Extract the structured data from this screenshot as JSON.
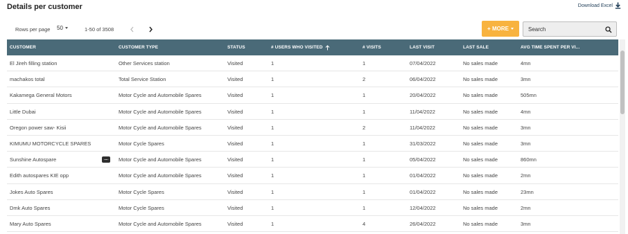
{
  "page": {
    "title": "Details per customer",
    "download_label": "Download Excel"
  },
  "toolbar": {
    "rows_per_page_label": "Rows per page",
    "rows_per_page_value": "50",
    "range_text": "1-50 of 3508",
    "more_label": "+ MORE",
    "search_placeholder": "Search"
  },
  "columns": [
    "CUSTOMER",
    "CUSTOMER TYPE",
    "STATUS",
    "# USERS WHO VISITED",
    "# VISITS",
    "LAST VISIT",
    "LAST SALE",
    "AVG TIME SPENT PER VI..."
  ],
  "sort": {
    "column": "# USERS WHO VISITED",
    "direction": "ascending"
  },
  "rows": [
    [
      "El Jireh filling station",
      "Other Services station",
      "Visited",
      "1",
      "1",
      "07/04/2022",
      "No sales made",
      "4mn"
    ],
    [
      "machakos total",
      "Total Service Station",
      "Visited",
      "1",
      "2",
      "06/04/2022",
      "No sales made",
      "3mn"
    ],
    [
      "Kakamega General Motors",
      "Motor Cycle and Automobile Spares",
      "Visited",
      "1",
      "1",
      "20/04/2022",
      "No sales made",
      "505mn"
    ],
    [
      "Little Dubai",
      "Motor Cycle and Automobile Spares",
      "Visited",
      "1",
      "1",
      "11/04/2022",
      "No sales made",
      "4mn"
    ],
    [
      "Oregon power saw- Kisii",
      "Motor Cycle and Automobile Spares",
      "Visited",
      "1",
      "2",
      "11/04/2022",
      "No sales made",
      "3mn"
    ],
    [
      "KIMUMU MOTORCYCLE SPARES",
      "Motor Cycle Spares",
      "Visited",
      "1",
      "1",
      "31/03/2022",
      "No sales made",
      "3mn"
    ],
    [
      "Sunshine Autospare",
      "Motor Cycle and Automobile Spares",
      "Visited",
      "1",
      "1",
      "05/04/2022",
      "No sales made",
      "860mn"
    ],
    [
      "Edith autospares KIE opp",
      "Motor Cycle and Automobile Spares",
      "Visited",
      "1",
      "1",
      "01/04/2022",
      "No sales made",
      "2mn"
    ],
    [
      "Jokes Auto Spares",
      "Motor Cycle Spares",
      "Visited",
      "1",
      "1",
      "01/04/2022",
      "No sales made",
      "23mn"
    ],
    [
      "Dmk Auto Spares",
      "Motor Cycle Spares",
      "Visited",
      "1",
      "1",
      "12/04/2022",
      "No sales made",
      "2mn"
    ],
    [
      "Mary Auto Spares",
      "Motor Cycle and Automobile Spares",
      "Visited",
      "1",
      "4",
      "26/04/2022",
      "No sales made",
      "3mn"
    ]
  ],
  "colors": {
    "header_bg": "#4a6a78",
    "more_button": "#f8b33f"
  },
  "icons": {
    "download": "download-icon",
    "search": "search-icon",
    "sort": "arrow-up-icon",
    "prev": "chevron-left-icon",
    "next": "chevron-right-icon",
    "row_actions": "more-horizontal-icon"
  }
}
